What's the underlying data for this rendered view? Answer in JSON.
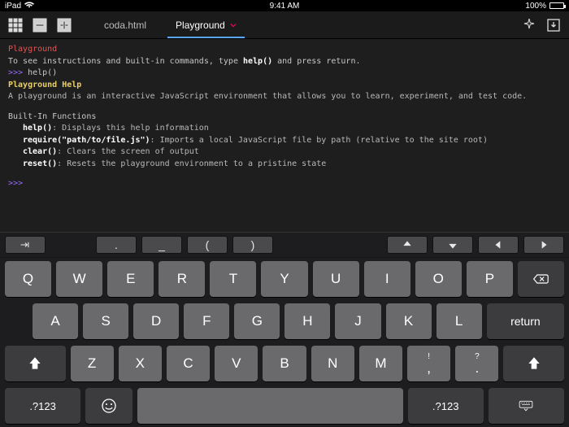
{
  "status": {
    "device": "iPad",
    "time": "9:41 AM",
    "battery_pct": "100%"
  },
  "toolbar": {
    "tabs": [
      {
        "label": "coda.html",
        "active": false
      },
      {
        "label": "Playground",
        "active": true
      }
    ]
  },
  "console": {
    "title": "Playground",
    "intro_pre": "To see instructions and built-in commands, type ",
    "intro_cmd": "help()",
    "intro_post": " and press return.",
    "prompt": ">>> ",
    "typed": "help()",
    "help_title": "Playground Help",
    "help_desc": "A playground is an interactive JavaScript environment that allows you to learn, experiment, and test code.",
    "builtins_heading": "Built-In Functions",
    "builtins": [
      {
        "fn": "help()",
        "desc": ": Displays this help information"
      },
      {
        "fn": "require(\"path/to/file.js\")",
        "desc": ": Imports a local JavaScript file by path (relative to the site root)"
      },
      {
        "fn": "clear()",
        "desc": ": Clears the screen of output"
      },
      {
        "fn": "reset()",
        "desc": ": Resets the playground environment to a pristine state"
      }
    ]
  },
  "accessory": {
    "dot": ".",
    "underscore": "_",
    "lparen": "(",
    "rparen": ")"
  },
  "keys": {
    "row1": [
      "Q",
      "W",
      "E",
      "R",
      "T",
      "Y",
      "U",
      "I",
      "O",
      "P"
    ],
    "row2": [
      "A",
      "S",
      "D",
      "F",
      "G",
      "H",
      "J",
      "K",
      "L"
    ],
    "row3": [
      "Z",
      "X",
      "C",
      "V",
      "B",
      "N",
      "M"
    ],
    "comma_top": "!",
    "comma": ",",
    "period_top": "?",
    "period": ".",
    "return": "return",
    "numsym": ".?123"
  }
}
